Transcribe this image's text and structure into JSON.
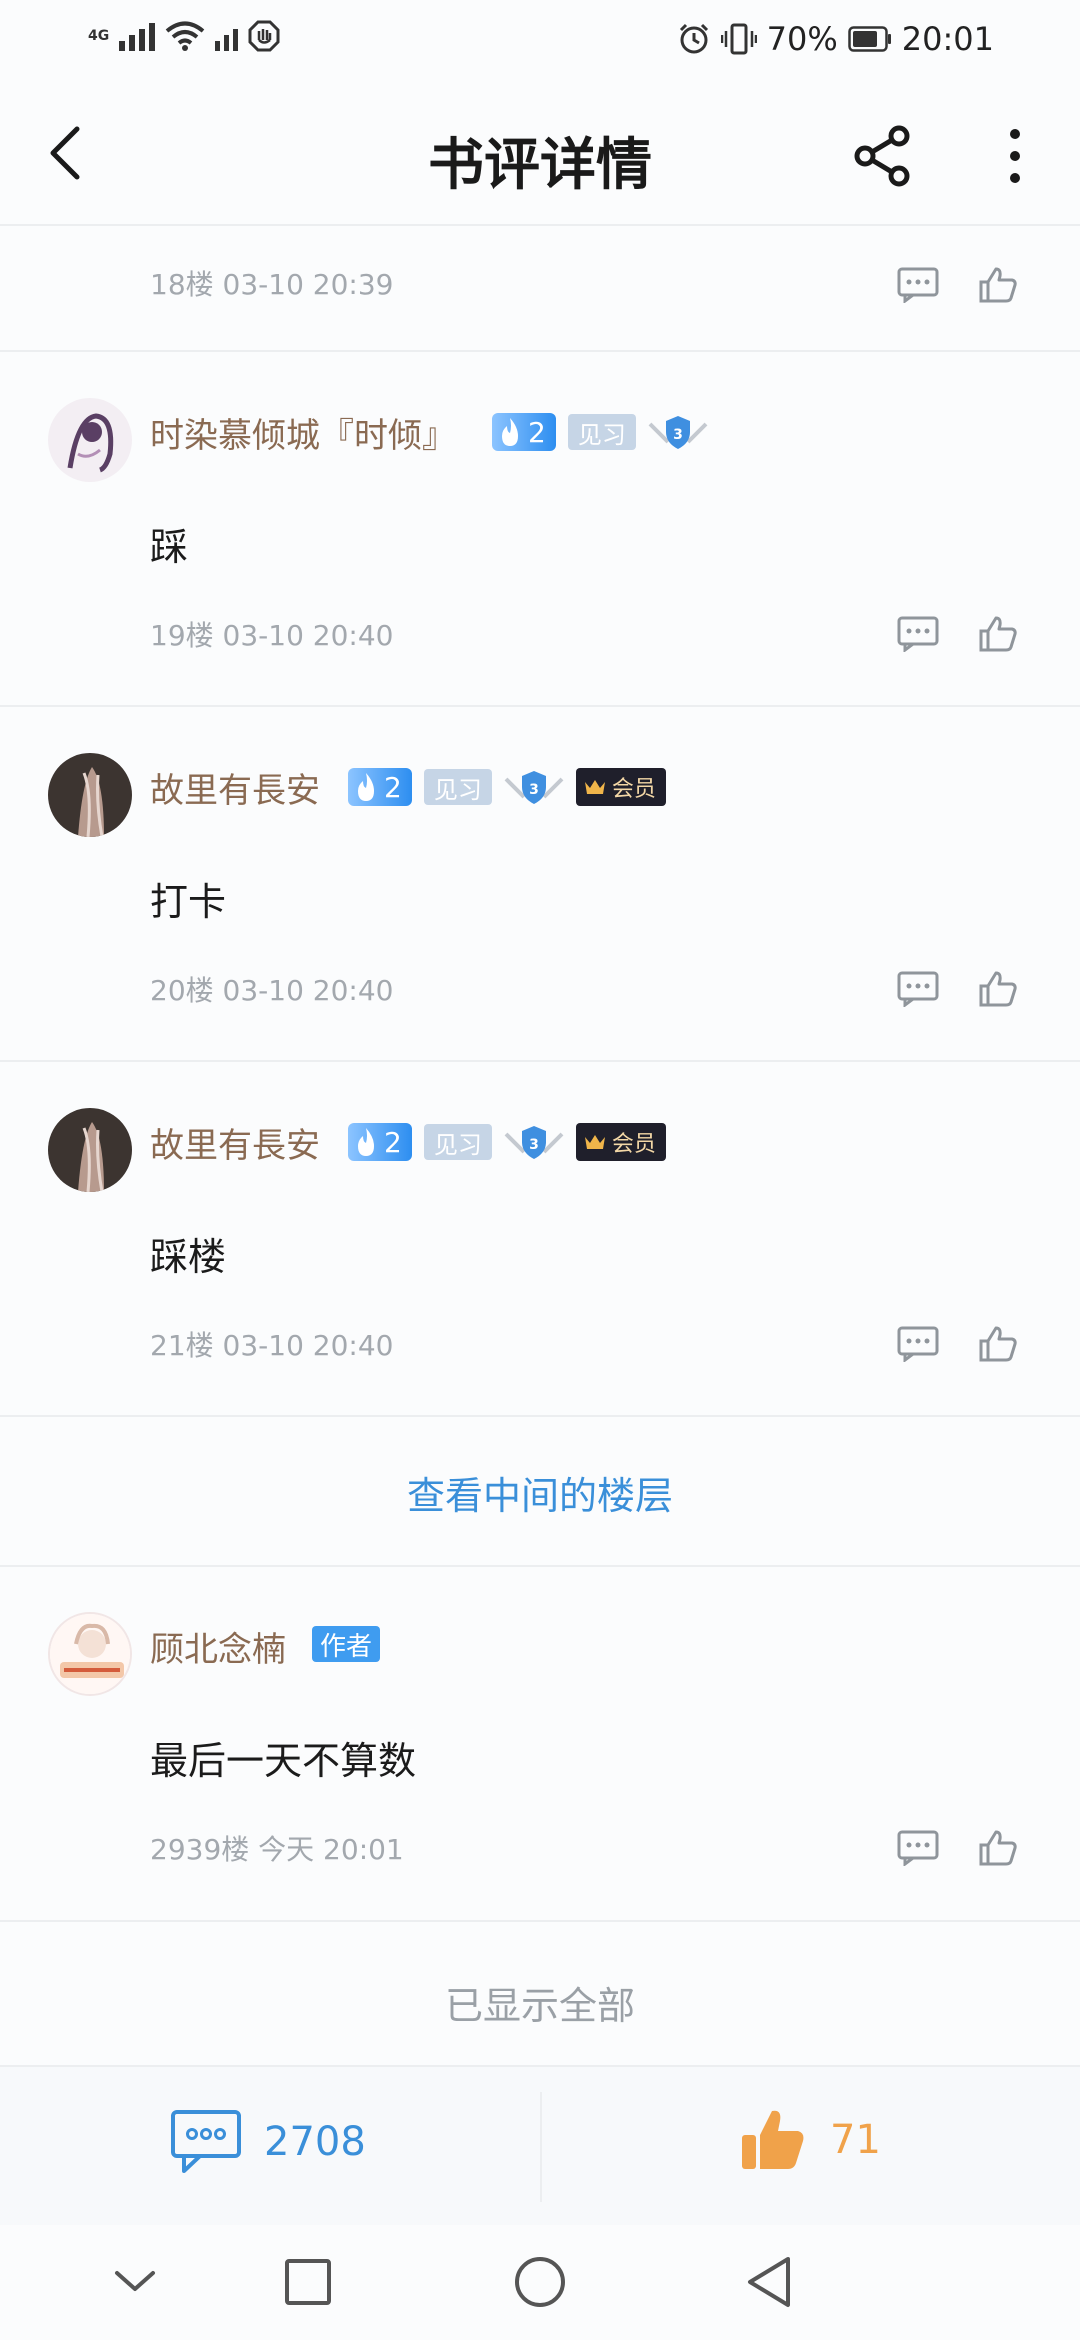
{
  "status_bar": {
    "network": "4G",
    "battery": "70%",
    "time": "20:01"
  },
  "header": {
    "title": "书评详情"
  },
  "top_floor": {
    "meta": "18楼 03-10 20:39"
  },
  "floors": [
    {
      "username": "时染慕倾城『时倾』",
      "fire_level": "2",
      "rank": "见习",
      "shield_level": "3",
      "content": "踩",
      "meta": "19楼 03-10 20:40"
    },
    {
      "username": "故里有長安",
      "fire_level": "2",
      "rank": "见习",
      "shield_level": "3",
      "member": "会员",
      "content": "打卡",
      "meta": "20楼 03-10 20:40"
    },
    {
      "username": "故里有長安",
      "fire_level": "2",
      "rank": "见习",
      "shield_level": "3",
      "member": "会员",
      "content": "踩楼",
      "meta": "21楼 03-10 20:40"
    }
  ],
  "view_middle": "查看中间的楼层",
  "author_floor": {
    "username": "顾北念楠",
    "tag": "作者",
    "content": "最后一天不算数",
    "meta": "2939楼 今天 20:01"
  },
  "all_shown": "已显示全部",
  "action_bar": {
    "comment_count": "2708",
    "like_count": "71"
  },
  "colors": {
    "username": "#8a6a52",
    "link_blue": "#3a8fd9",
    "like_orange": "#f0a24a"
  }
}
